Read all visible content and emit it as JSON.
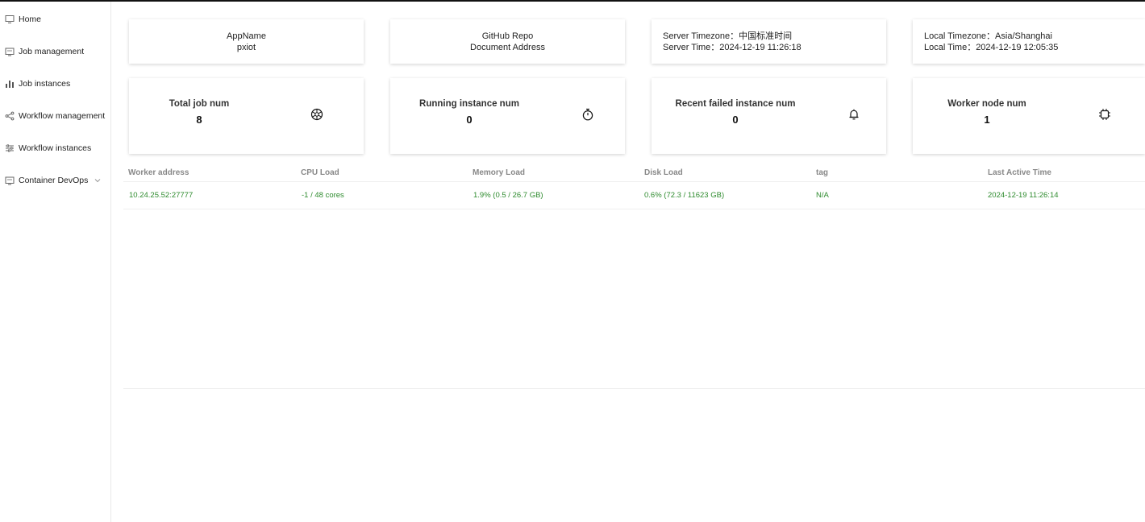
{
  "sidebar": {
    "items": [
      {
        "label": "Home",
        "icon": "desktop-icon"
      },
      {
        "label": "Job management",
        "icon": "folder-icon"
      },
      {
        "label": "Job instances",
        "icon": "bar-chart-icon"
      },
      {
        "label": "Workflow management",
        "icon": "share-icon"
      },
      {
        "label": "Workflow instances",
        "icon": "sliders-icon"
      },
      {
        "label": "Container DevOps",
        "icon": "folder-icon",
        "expandable": true
      }
    ]
  },
  "info": {
    "app_name_label": "AppName",
    "app_name_value": "pxiot",
    "github_repo": "GitHub Repo",
    "document_address": "Document Address",
    "server_timezone": "Server Timezone：中国标准时间",
    "server_time": "Server Time：2024-12-19 11:26:18",
    "local_timezone": "Local Timezone：Asia/Shanghai",
    "local_time": "Local Time：2024-12-19 12:05:35"
  },
  "stats": {
    "total_job": {
      "label": "Total job num",
      "value": "8",
      "icon": "aperture-icon"
    },
    "running": {
      "label": "Running instance num",
      "value": "0",
      "icon": "stopwatch-icon"
    },
    "failed": {
      "label": "Recent failed instance num",
      "value": "0",
      "icon": "bell-icon"
    },
    "workers": {
      "label": "Worker node num",
      "value": "1",
      "icon": "chip-icon"
    }
  },
  "workers_table": {
    "headers": [
      "Worker address",
      "CPU Load",
      "Memory Load",
      "Disk Load",
      "tag",
      "Last Active Time"
    ],
    "rows": [
      [
        "10.24.25.52:27777",
        "-1 / 48 cores",
        "1.9%  (0.5 / 26.7 GB)",
        "0.6%  (72.3 / 11623 GB)",
        "N/A",
        "2024-12-19 11:26:14"
      ]
    ]
  },
  "colors": {
    "accent_green": "#2e8b2e",
    "header_gray": "#888888"
  }
}
